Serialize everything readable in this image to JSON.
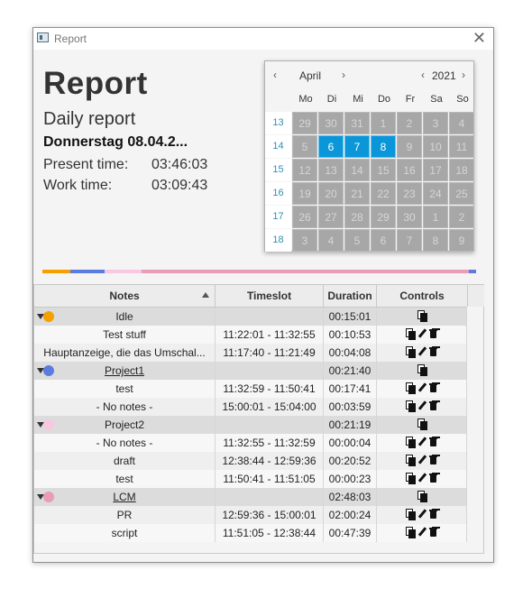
{
  "window": {
    "title": "Report",
    "close_label": "✕"
  },
  "header": {
    "title": "Report",
    "subtitle": "Daily report",
    "date": "Donnerstag 08.04.2...",
    "present_label": "Present time:",
    "present_value": "03:46:03",
    "work_label": "Work time:",
    "work_value": "03:09:43"
  },
  "calendar": {
    "month": "April",
    "year": "2021",
    "prev": "‹",
    "next": "›",
    "weekdays": [
      "Mo",
      "Di",
      "Mi",
      "Do",
      "Fr",
      "Sa",
      "So"
    ],
    "weeks": [
      {
        "wk": "13",
        "days": [
          "29",
          "30",
          "31",
          "1",
          "2",
          "3",
          "4"
        ]
      },
      {
        "wk": "14",
        "days": [
          "5",
          "6",
          "7",
          "8",
          "9",
          "10",
          "11"
        ]
      },
      {
        "wk": "15",
        "days": [
          "12",
          "13",
          "14",
          "15",
          "16",
          "17",
          "18"
        ]
      },
      {
        "wk": "16",
        "days": [
          "19",
          "20",
          "21",
          "22",
          "23",
          "24",
          "25"
        ]
      },
      {
        "wk": "17",
        "days": [
          "26",
          "27",
          "28",
          "29",
          "30",
          "1",
          "2"
        ]
      },
      {
        "wk": "18",
        "days": [
          "3",
          "4",
          "5",
          "6",
          "7",
          "8",
          "9"
        ]
      }
    ],
    "selected_days": [
      "6",
      "7",
      "8"
    ]
  },
  "colors": {
    "idle": "#f5a000",
    "project1": "#5b7be0",
    "project2": "#f7c8e0",
    "lcm": "#e89cb8",
    "selection": "#0a96d8"
  },
  "colorbar_fractions": [
    {
      "color": "#f5a000",
      "frac": 0.065
    },
    {
      "color": "#5b7be0",
      "frac": 0.078
    },
    {
      "color": "#e89cb8",
      "frac": 0.0
    },
    {
      "color": "#f7c8e0",
      "frac": 0.085
    },
    {
      "color": "#e89cb8",
      "frac": 0.755
    },
    {
      "color": "#5b7be0",
      "frac": 0.017
    }
  ],
  "table": {
    "headers": {
      "notes": "Notes",
      "timeslot": "Timeslot",
      "duration": "Duration",
      "controls": "Controls"
    },
    "rows": [
      {
        "type": "group",
        "color": "#f5a000",
        "notes": "Idle",
        "underline": false,
        "timeslot": "",
        "duration": "00:15:01"
      },
      {
        "type": "item",
        "notes": "Test stuff",
        "timeslot": "11:22:01 - 11:32:55",
        "duration": "00:10:53"
      },
      {
        "type": "item",
        "notes": "Hauptanzeige, die das Umschal...",
        "timeslot": "11:17:40 - 11:21:49",
        "duration": "00:04:08"
      },
      {
        "type": "group",
        "color": "#5b7be0",
        "notes": "Project1",
        "underline": true,
        "timeslot": "",
        "duration": "00:21:40"
      },
      {
        "type": "item",
        "notes": "test",
        "timeslot": "11:32:59 - 11:50:41",
        "duration": "00:17:41"
      },
      {
        "type": "item",
        "notes": "- No notes -",
        "timeslot": "15:00:01 - 15:04:00",
        "duration": "00:03:59"
      },
      {
        "type": "group",
        "color": "#f7c8e0",
        "notes": "Project2",
        "underline": false,
        "timeslot": "",
        "duration": "00:21:19"
      },
      {
        "type": "item",
        "notes": "- No notes -",
        "timeslot": "11:32:55 - 11:32:59",
        "duration": "00:00:04"
      },
      {
        "type": "item",
        "notes": "draft",
        "timeslot": "12:38:44 - 12:59:36",
        "duration": "00:20:52"
      },
      {
        "type": "item",
        "notes": "test",
        "timeslot": "11:50:41 - 11:51:05",
        "duration": "00:00:23"
      },
      {
        "type": "group",
        "color": "#e89cb8",
        "notes": "LCM",
        "underline": true,
        "timeslot": "",
        "duration": "02:48:03"
      },
      {
        "type": "item",
        "notes": "PR",
        "timeslot": "12:59:36 - 15:00:01",
        "duration": "02:00:24"
      },
      {
        "type": "item",
        "notes": "script",
        "timeslot": "11:51:05 - 12:38:44",
        "duration": "00:47:39"
      }
    ]
  }
}
